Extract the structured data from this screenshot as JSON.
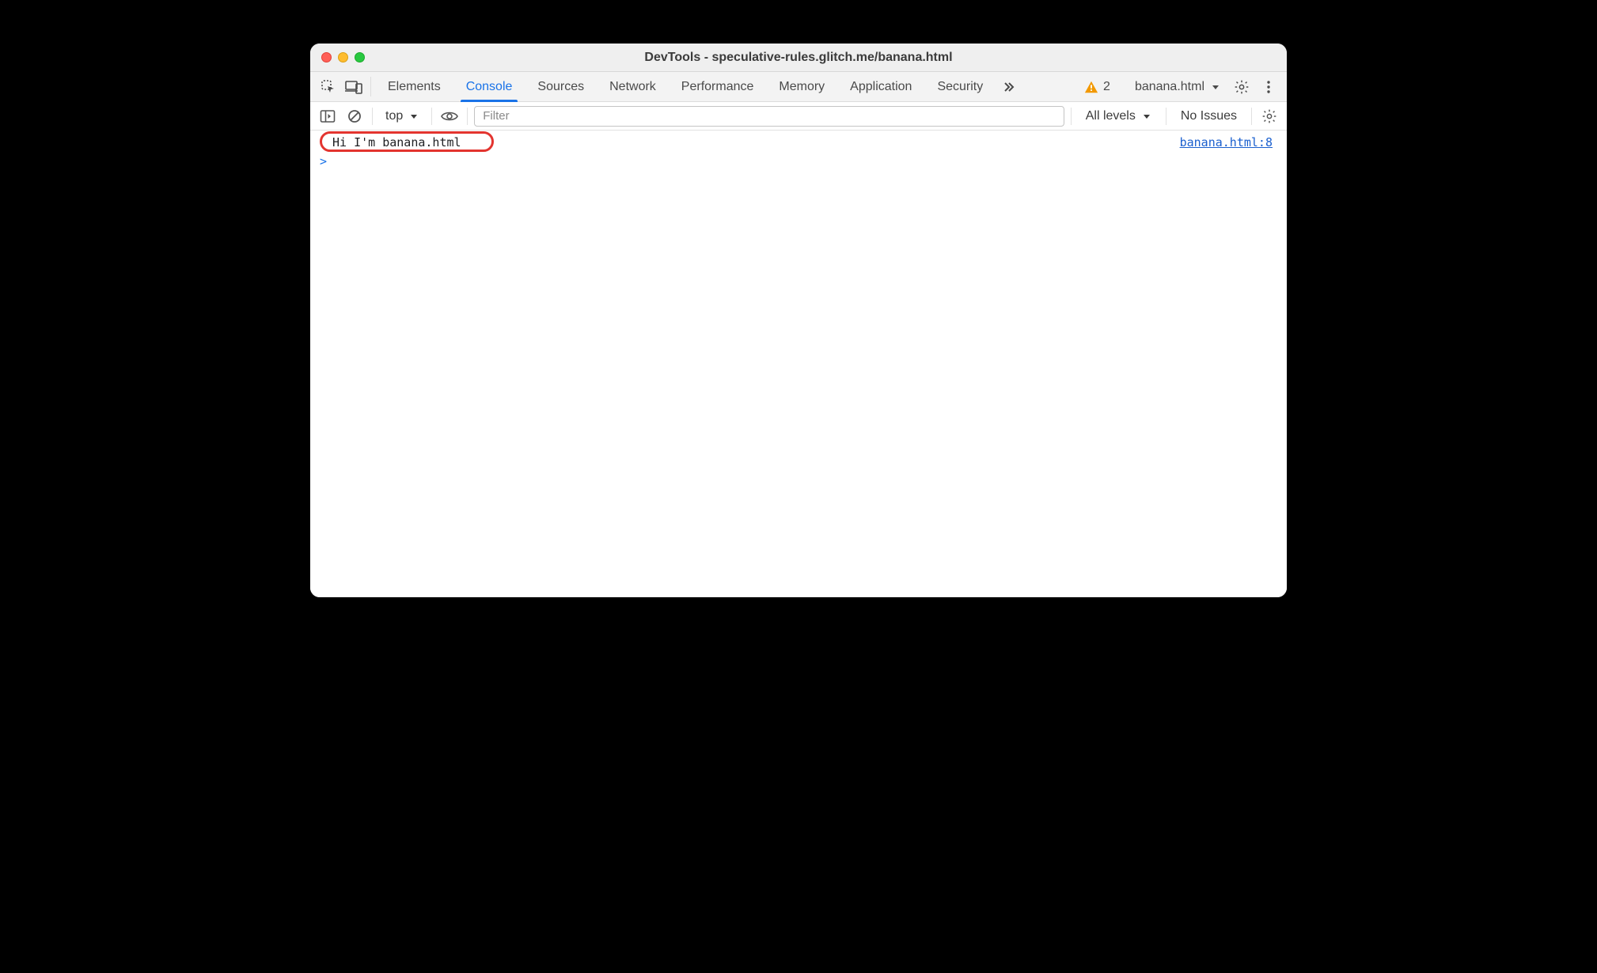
{
  "window": {
    "title": "DevTools - speculative-rules.glitch.me/banana.html"
  },
  "tabs": {
    "items": [
      {
        "label": "Elements"
      },
      {
        "label": "Console"
      },
      {
        "label": "Sources"
      },
      {
        "label": "Network"
      },
      {
        "label": "Performance"
      },
      {
        "label": "Memory"
      },
      {
        "label": "Application"
      },
      {
        "label": "Security"
      }
    ],
    "active_index": 1,
    "warnings_count": "2",
    "target_name": "banana.html"
  },
  "console_toolbar": {
    "context": "top",
    "filter_placeholder": "Filter",
    "levels_label": "All levels",
    "issues_label": "No Issues"
  },
  "console": {
    "log_message": "Hi I'm banana.html",
    "log_source": "banana.html:8",
    "prompt": ">"
  }
}
